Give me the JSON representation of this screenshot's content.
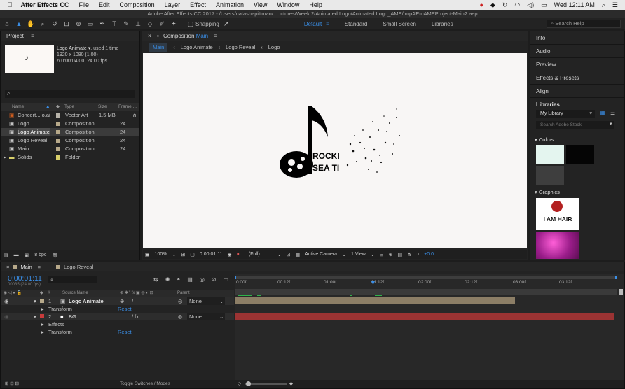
{
  "menubar": {
    "app": "After Effects CC",
    "items": [
      "File",
      "Edit",
      "Composition",
      "Layer",
      "Effect",
      "Animation",
      "View",
      "Window",
      "Help"
    ],
    "clock": "Wed 12:11 AM"
  },
  "titlebar": "Adobe After Effects CC 2017 - /Users/natashapittman/ ... ctures/Week 2/Animated Logo/Animated Logo_AME/tmpAEtoAMEProject-Main2.aep",
  "toolbar": {
    "snapping": "Snapping",
    "workspaces": [
      "Default",
      "Standard",
      "Small Screen",
      "Libraries"
    ],
    "search_placeholder": "Search Help"
  },
  "project": {
    "title": "Project",
    "preview": {
      "name": "Logo Animate ▾",
      "used": ", used 1 time",
      "res": "1920 x 1080 (1.00)",
      "dur": "Δ 0:00:04:00, 24.00 fps"
    },
    "columns": {
      "name": "Name",
      "type": "Type",
      "size": "Size",
      "frame": "Frame ..."
    },
    "items": [
      {
        "name": "Concert....o.ai",
        "type": "Vector Art",
        "size": "1.5 MB",
        "frame": "",
        "color": "#b7b3a9"
      },
      {
        "name": "Logo",
        "type": "Composition",
        "size": "",
        "frame": "24",
        "color": "#b7a98a"
      },
      {
        "name": "Logo Animate",
        "type": "Composition",
        "size": "",
        "frame": "24",
        "color": "#b7a98a"
      },
      {
        "name": "Logo Reveal",
        "type": "Composition",
        "size": "",
        "frame": "24",
        "color": "#b7a98a"
      },
      {
        "name": "Main",
        "type": "Composition",
        "size": "",
        "frame": "24",
        "color": "#b7a98a"
      },
      {
        "name": "Solids",
        "type": "Folder",
        "size": "",
        "frame": "",
        "color": "#d8cf6a"
      }
    ],
    "bpc": "8 bpc"
  },
  "comp": {
    "title": "Composition",
    "title_name": "Main",
    "breadcrumbs": [
      "Main",
      "Logo Animate",
      "Logo Reveal",
      "Logo"
    ],
    "logo_text_1": "ROCKI",
    "logo_text_2": "SEA TI",
    "footer": {
      "zoom": "100%",
      "time": "0:00:01:11",
      "res": "(Full)",
      "camera": "Active Camera",
      "view": "1 View",
      "exposure": "+0.0"
    }
  },
  "right": {
    "panels": [
      "Info",
      "Audio",
      "Preview",
      "Effects & Presets",
      "Align",
      "Libraries"
    ],
    "library": "My Library",
    "stock_placeholder": "Search Adobe Stock",
    "colors_label": "Colors",
    "swatches": [
      "#e4f5ef",
      "#050505",
      "#3e3e3e"
    ],
    "graphics_label": "Graphics",
    "graphic_text": "I AM HAIR"
  },
  "timeline": {
    "tabs": [
      "Main",
      "Logo Reveal"
    ],
    "timecode": "0:00:01:11",
    "timecode_sub": "00035 (24.00 fps)",
    "col_source": "Source Name",
    "col_parent": "Parent",
    "ruler": [
      "0:00f",
      "00:12f",
      "01:00f",
      "01:12f",
      "02:00f",
      "02:12f",
      "03:00f",
      "03:12f"
    ],
    "layers": [
      {
        "num": "1",
        "name": "Logo Animate",
        "parent": "None",
        "color": "#b7a98a"
      },
      {
        "num": "2",
        "name": "BG",
        "parent": "None",
        "color": "#c93b3b"
      }
    ],
    "sub_transform": "Transform",
    "sub_effects": "Effects",
    "reset": "Reset",
    "toggle_label": "Toggle Switches / Modes"
  }
}
